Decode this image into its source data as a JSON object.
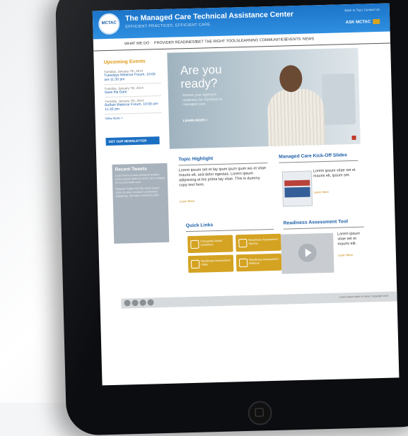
{
  "site": {
    "logo_text": "MCTAC",
    "title": "The Managed Care Technical Assistance Center",
    "tagline": "EFFICIENT PRACTICES. EFFICIENT CARE.",
    "utility_links": "Back to Top | Contact Us",
    "ask_label": "ASK MCTAC"
  },
  "nav": [
    "WHAT WE DO",
    "PROVIDER READINESS",
    "GET THE RIGHT TOOLS",
    "LEARNING COMMUNITIES",
    "EVENTS",
    "NEWS"
  ],
  "upcoming": {
    "title": "Upcoming Events",
    "events": [
      {
        "date": "Tuesday, January 7th, 2014",
        "title": "Tuesdays Webinar Forum, 10:00 am-11:30 pm"
      },
      {
        "date": "Tuesday, January 7th, 2014",
        "title": "Save the Date"
      },
      {
        "date": "Tuesday, January 7th, 2014",
        "title": "Buffalo Webinar Forum, 10:00 am-11:30 pm"
      }
    ],
    "view_more": "View more >",
    "newsletter": "GET OUR NEWSLETTER"
  },
  "tweets": {
    "title": "Recent Tweets",
    "items": [
      "Cras Omnis ut diam tincidunt facilisis. Lorem ipsum dolor sit amet, nisl ut aliquip ex ea commodo cons.",
      "Retweet Twitter MCTAC lorem ipsum dolor sit amet, tincidunt consectetur adipiscing. Sed diam nonummy nibh."
    ]
  },
  "hero": {
    "headline": "Are you ready?",
    "blurb": "Assess your agency's readiness for transition to managed care.",
    "cta": "LEARN MORE >"
  },
  "topic": {
    "title": "Topic Highlight",
    "text": "Lorem ipsum set et lay ipum ipum ipum ies et vitae mauris elt, sed dolor egestas. Lorem ipsum adipiscing et les prima lay vitae. This is dummy copy text here.",
    "more": "Learn More"
  },
  "kickoff": {
    "title": "Managed Care Kick-Off Slides",
    "text": "Lorem ipsum vitae set et mauris elt, ipsum set.",
    "more": "Learn More"
  },
  "quick_links": {
    "title": "Quick Links",
    "items": [
      {
        "label": "Frequently Asked Questions",
        "icon": "faq-icon"
      },
      {
        "label": "Readiness Assessment Agency",
        "icon": "building-icon"
      },
      {
        "label": "Readiness Assessment Video",
        "icon": "video-icon"
      },
      {
        "label": "Readiness Assessment Webinar",
        "icon": "webinar-icon"
      }
    ]
  },
  "readiness_tool": {
    "title": "Readiness Assessment Tool",
    "text": "Lorem ipsum vitae set et mauris elit.",
    "more": "Learn More"
  },
  "footer": {
    "copyright": "Lorem ipsum dolor sit amet, Copyright 2014",
    "social_icons": [
      "facebook-icon",
      "twitter-icon",
      "youtube-icon",
      "linkedin-icon"
    ]
  },
  "colors": {
    "header": "#2f8fe0",
    "accent": "#d4a322",
    "link": "#1d5fa8"
  }
}
